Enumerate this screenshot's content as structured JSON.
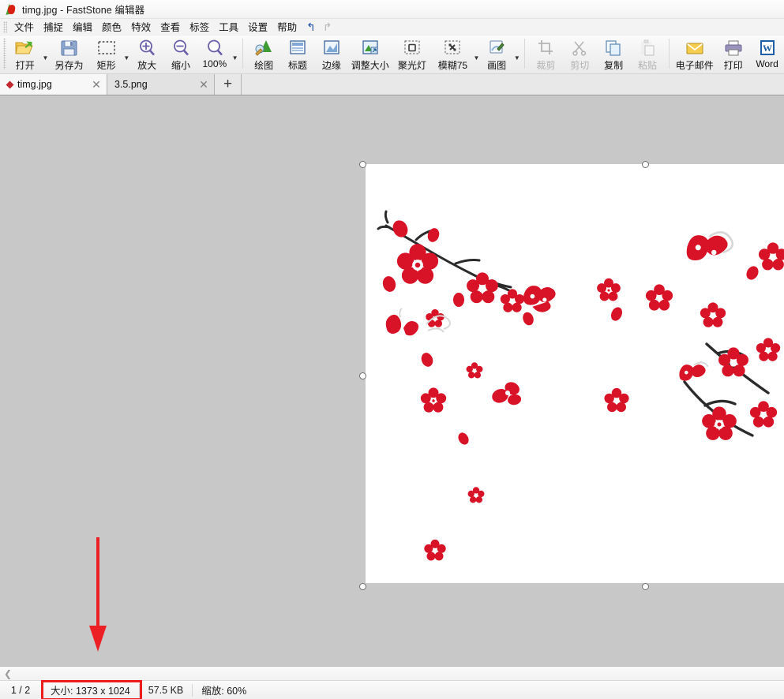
{
  "window": {
    "title": "timg.jpg - FastStone 编辑器",
    "logo_icon": "faststone-logo-icon"
  },
  "menubar": {
    "items": [
      {
        "label": "文件"
      },
      {
        "label": "捕捉"
      },
      {
        "label": "编辑"
      },
      {
        "label": "颜色"
      },
      {
        "label": "特效"
      },
      {
        "label": "查看"
      },
      {
        "label": "标签"
      },
      {
        "label": "工具"
      },
      {
        "label": "设置"
      },
      {
        "label": "帮助"
      }
    ],
    "undo_icon": "undo-arrow-icon",
    "undo_glyph": "↰",
    "redo_icon": "redo-arrow-icon",
    "redo_glyph": "↱"
  },
  "toolbar": {
    "buttons": [
      {
        "label": "打开",
        "icon": "open-folder-icon",
        "disabled": false,
        "dropdown": true
      },
      {
        "label": "另存为",
        "icon": "save-as-icon",
        "disabled": false,
        "dropdown": false
      },
      {
        "label": "矩形",
        "icon": "rectangle-select-icon",
        "disabled": false,
        "dropdown": true
      },
      {
        "label": "放大",
        "icon": "zoom-in-icon",
        "disabled": false,
        "dropdown": false
      },
      {
        "label": "缩小",
        "icon": "zoom-out-icon",
        "disabled": false,
        "dropdown": false
      },
      {
        "label": "100%",
        "icon": "zoom-actual-icon",
        "disabled": false,
        "dropdown": true
      },
      {
        "label": "绘图",
        "icon": "draw-icon",
        "disabled": false,
        "dropdown": false
      },
      {
        "label": "标题",
        "icon": "caption-icon",
        "disabled": false,
        "dropdown": false
      },
      {
        "label": "边缘",
        "icon": "edge-effect-icon",
        "disabled": false,
        "dropdown": false
      },
      {
        "label": "调整大小",
        "icon": "resize-icon",
        "disabled": false,
        "dropdown": false
      },
      {
        "label": "聚光灯",
        "icon": "spotlight-icon",
        "disabled": false,
        "dropdown": false
      },
      {
        "label": "模糊75",
        "icon": "blur-icon",
        "disabled": false,
        "dropdown": true
      },
      {
        "label": "画图",
        "icon": "paint-icon",
        "disabled": false,
        "dropdown": true
      },
      {
        "label": "裁剪",
        "icon": "crop-icon",
        "disabled": true,
        "dropdown": false
      },
      {
        "label": "剪切",
        "icon": "scissors-icon",
        "disabled": true,
        "dropdown": false
      },
      {
        "label": "复制",
        "icon": "copy-icon",
        "disabled": false,
        "dropdown": false
      },
      {
        "label": "粘贴",
        "icon": "paste-icon",
        "disabled": true,
        "dropdown": false
      },
      {
        "label": "电子邮件",
        "icon": "email-envelope-icon",
        "disabled": false,
        "dropdown": false
      },
      {
        "label": "打印",
        "icon": "printer-icon",
        "disabled": false,
        "dropdown": false
      },
      {
        "label": "Word",
        "icon": "word-document-icon",
        "disabled": false,
        "dropdown": false
      }
    ]
  },
  "tabs": {
    "items": [
      {
        "name": "timg.jpg",
        "active": true,
        "modified": true,
        "close_icon": "close-icon",
        "close_glyph": "✕"
      },
      {
        "name": "3.5.png",
        "active": false,
        "modified": false,
        "close_icon": "close-icon",
        "close_glyph": "✕"
      }
    ],
    "add_tab_glyph": "+",
    "add_tab_icon": "plus-icon"
  },
  "canvas": {
    "image_name": "timg.jpg",
    "description": "红色梅花与蝴蝶图案",
    "selection_handles": 6,
    "annotation": {
      "type": "arrow",
      "icon": "red-down-arrow-annotation",
      "color": "#ec2024",
      "direction": "down"
    }
  },
  "filmstrip": {
    "prev_glyph": "❮",
    "prev_icon": "chevron-left-icon"
  },
  "statusbar": {
    "pages": "1 / 2",
    "size": "大小: 1373 x 1024",
    "filesize": "57.5 KB",
    "zoom": "缩放: 60%",
    "highlight_color": "#ee1d1d"
  }
}
